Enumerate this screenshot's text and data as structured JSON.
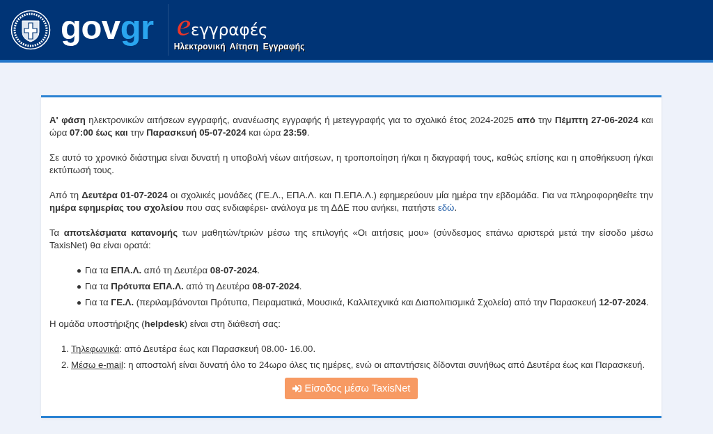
{
  "header": {
    "brand": {
      "primary": "gov",
      "accent": "gr"
    },
    "service": {
      "initial": "e",
      "name": "εγγραφές",
      "subtitle": "Ηλεκτρονική Αίτηση Εγγραφής"
    }
  },
  "content": {
    "blocks": [
      {
        "kind": "paragraph",
        "text": "**Α' φάση** ηλεκτρονικών αιτήσεων εγγραφής, ανανέωσης εγγραφής ή μετεγγραφής για το σχολικό έτος 2024-2025 **από** την **Πέμπτη 27-06-2024** και ώρα **07:00 έως και** την **Παρασκευή 05-07-2024** και ώρα **23:59**."
      },
      {
        "kind": "paragraph",
        "text": "Σε αυτό το χρονικό διάστημα είναι δυνατή η υποβολή νέων αιτήσεων, η τροποποίηση ή/και η διαγραφή τους, καθώς επίσης και η αποθήκευση ή/και εκτύπωσή τους."
      },
      {
        "kind": "paragraph",
        "text": "Από τη **Δευτέρα 01-07-2024** οι σχολικές μονάδες (ΓΕ.Λ., ΕΠΑ.Λ. και Π.ΕΠΑ.Λ.) εφημερεύουν μία ημέρα την εβδομάδα. Για να πληροφορηθείτε την **ημέρα εφημερίας του σχολείου** που σας ενδιαφέρει- ανάλογα με τη ΔΔΕ που ανήκει, πατήστε ",
        "link": "εδώ",
        "after": "."
      },
      {
        "kind": "paragraph",
        "text": "Τα **αποτελέσματα κατανομής** των μαθητών/τριών μέσω της επιλογής «Οι αιτήσεις μου» (σύνδεσμος επάνω αριστερά μετά την είσοδο μέσω TaxisNet) θα είναι ορατά:"
      },
      {
        "kind": "bullet_list",
        "items": [
          {
            "text": "Για τα **ΕΠΑ.Λ.** από τη Δευτέρα **08-07-2024**."
          },
          {
            "text": "Για τα **Πρότυπα ΕΠΑ.Λ.** από τη Δευτέρα **08-07-2024**."
          },
          {
            "text": "Για τα **ΓΕ.Λ.** (περιλαμβάνονται Πρότυπα, Πειραματικά, Μουσικά, Καλλιτεχνικά και Διαπολιτισμικά Σχολεία) από την Παρασκευή **12-07-2024**."
          }
        ]
      },
      {
        "kind": "paragraph",
        "text": "Η ομάδα υποστήριξης (**helpdesk**) είναι στη διάθεσή σας:"
      },
      {
        "kind": "numbered_list",
        "items": [
          {
            "marker": "1.",
            "label": "Τηλεφωνικά",
            "text": ": από Δευτέρα έως και Παρασκευή 08.00- 16.00."
          },
          {
            "marker": "2.",
            "label": "Μέσω e-mail",
            "text": ": η αποστολή είναι δυνατή όλο το 24ωρο όλες τις ημέρες, ενώ οι απαντήσεις δίδονται συνήθως από Δευτέρα έως και Παρασκευή."
          }
        ]
      }
    ],
    "login_button": {
      "label": "Είσοδος μέσω TaxisNet"
    }
  }
}
